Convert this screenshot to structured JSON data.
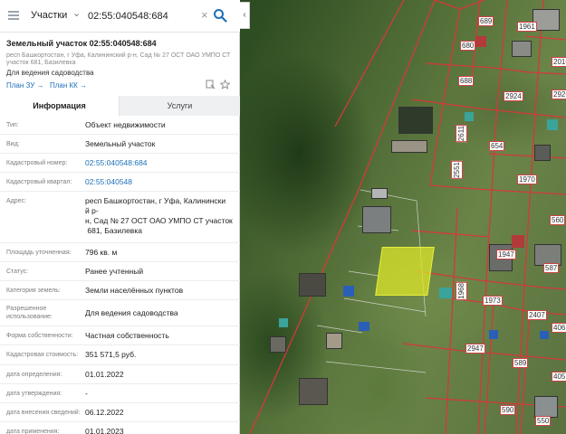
{
  "search": {
    "layer": "Участки",
    "query": "02:55:040548:684"
  },
  "parcel": {
    "title": "Земельный участок 02:55:040548:684",
    "address_short": "респ Башкортостан, г Уфа, Калининский р-н, Сад № 27 ОСТ ОАО УМПО СТ участок 681, Базилевка",
    "purpose": "Для ведения садоводства",
    "plan_zu": "План ЗУ →",
    "plan_kk": "План КК →"
  },
  "tabs": {
    "info": "Информация",
    "services": "Услуги"
  },
  "rows": [
    {
      "key": "Тип:",
      "value": "Объект недвижимости"
    },
    {
      "key": "Вид:",
      "value": "Земельный участок"
    },
    {
      "key": "Кадастровый номер:",
      "value": "02:55:040548:684"
    },
    {
      "key": "Кадастровый квартал:",
      "value": "02:55:040548"
    },
    {
      "key": "Адрес:",
      "value_lines": [
        "респ Башкортостан, г Уфа, Калинински",
        "й р-",
        "н, Сад № 27 ОСТ ОАО УМПО СТ участок",
        " 681, Базилевка"
      ]
    },
    {
      "key": "Площадь уточненная:",
      "value": "796 кв. м"
    },
    {
      "key": "Статус:",
      "value": "Ранее учтенный"
    },
    {
      "key": "Категория земель:",
      "value": "Земли населённых пунктов"
    },
    {
      "key_lines": [
        "Разрешенное",
        "использование:"
      ],
      "value": "Для ведения садоводства"
    },
    {
      "key": "Форма собственности:",
      "value": "Частная собственность"
    },
    {
      "key": "Кадастровая стоимость:",
      "value": "351 571,5 руб."
    },
    {
      "key": "дата определения:",
      "value": "01.01.2022"
    },
    {
      "key": "дата утверждения:",
      "value": "-"
    },
    {
      "key": "дата внесения сведений:",
      "value": "06.12.2022"
    },
    {
      "key": "дата применения:",
      "value": "01.01.2023"
    }
  ],
  "map_labels": [
    "689",
    "1961",
    "680",
    "2016",
    "688",
    "2924",
    "2926",
    "654",
    "1970",
    "2551",
    "2611",
    "1947",
    "587",
    "1973",
    "1968",
    "2407",
    "4061",
    "2947",
    "589",
    "4057",
    "590",
    "550",
    "560",
    "1961"
  ],
  "colors": {
    "accent": "#1e6fb8",
    "parcel_highlight": "#dce628",
    "parcel_border": "#cc3333"
  },
  "icons": [
    "menu-icon",
    "chevron-down-icon",
    "clear-icon",
    "search-icon",
    "collapse-icon",
    "print-icon",
    "star-icon"
  ]
}
